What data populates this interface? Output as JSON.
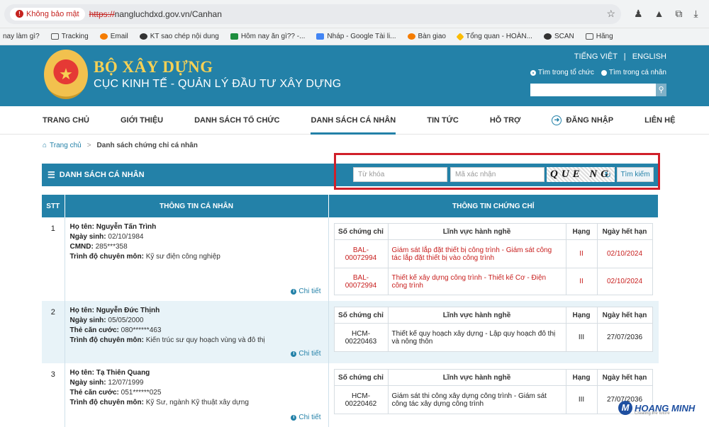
{
  "browser": {
    "security_label": "Không bảo mật",
    "url_protocol": "https://",
    "url_rest": "nangluchdxd.gov.vn/Canhan",
    "bookmarks": [
      {
        "label": "nay làm gì?",
        "icon": "none"
      },
      {
        "label": "Tracking",
        "icon": "folder-icon"
      },
      {
        "label": "Email",
        "icon": "link-icon"
      },
      {
        "label": "KT sao chép nội dung",
        "icon": "person-icon"
      },
      {
        "label": "Hôm nay ăn gì?? -...",
        "icon": "sheet-icon"
      },
      {
        "label": "Nháp - Google Tài li...",
        "icon": "doc-icon"
      },
      {
        "label": "Bàn giao",
        "icon": "link-icon"
      },
      {
        "label": "Tổng quan - HOÀN...",
        "icon": "drive-icon"
      },
      {
        "label": "SCAN",
        "icon": "globe-icon"
      },
      {
        "label": "Hãng",
        "icon": "folder-icon"
      }
    ]
  },
  "header": {
    "title": "BỘ XÂY DỰNG",
    "subtitle": "CỤC KINH TẾ - QUẢN LÝ ĐẦU TƯ XÂY DỰNG",
    "lang_vi": "TIẾNG VIỆT",
    "lang_sep": "|",
    "lang_en": "ENGLISH",
    "radio_org": "Tìm trong tổ chức",
    "radio_person": "Tìm trong cá nhân"
  },
  "nav": {
    "items": [
      "TRANG CHỦ",
      "GIỚI THIỆU",
      "DANH SÁCH TỔ CHỨC",
      "DANH SÁCH CÁ NHÂN",
      "TIN TỨC",
      "HỖ TRỢ",
      "ĐĂNG NHẬP",
      "LIÊN HỆ"
    ]
  },
  "breadcrumb": {
    "home": "Trang chủ",
    "current": "Danh sách chứng chỉ cá nhân"
  },
  "list": {
    "title": "DANH SÁCH CÁ NHÂN",
    "keyword_placeholder": "Từ khóa",
    "captcha_placeholder": "Mã xác nhận",
    "captcha_text": "QUE NG",
    "search_button": "Tìm kiếm"
  },
  "table": {
    "col_stt": "STT",
    "col_personal": "THÔNG TIN CÁ NHÂN",
    "col_cert": "THÔNG TIN CHỨNG CHỈ",
    "cert_headers": [
      "Số chứng chỉ",
      "Lĩnh vực hành nghề",
      "Hạng",
      "Ngày hết hạn"
    ],
    "detail_label": "Chi tiết",
    "rows": [
      {
        "stt": "1",
        "name_label": "Họ tên:",
        "name": "Nguyễn Tấn Trình",
        "dob_label": "Ngày sinh:",
        "dob": "02/10/1984",
        "id_label": "CMND:",
        "id": "285***358",
        "edu_label": "Trình độ chuyên môn:",
        "edu": "Kỹ sư điện công nghiệp",
        "certs": [
          {
            "no": "BAL-00072994",
            "field": "Giám sát lắp đặt thiết bị công trình - Giám sát công tác lắp đặt thiết bị vào công trình",
            "grade": "II",
            "expiry": "02/10/2024"
          },
          {
            "no": "BAL-00072994",
            "field": "Thiết kế xây dựng công trình - Thiết kế Cơ - Điện công trình",
            "grade": "II",
            "expiry": "02/10/2024"
          }
        ]
      },
      {
        "stt": "2",
        "name_label": "Họ tên:",
        "name": "Nguyễn Đức Thịnh",
        "dob_label": "Ngày sinh:",
        "dob": "05/05/2000",
        "id_label": "Thẻ căn cước:",
        "id": "080******463",
        "edu_label": "Trình độ chuyên môn:",
        "edu": "Kiến trúc sư quy hoạch vùng và đô thị",
        "certs": [
          {
            "no": "HCM-00220463",
            "field": "Thiết kế quy hoạch xây dựng - Lập quy hoạch đô thị và nông thôn",
            "grade": "III",
            "expiry": "27/07/2036"
          }
        ]
      },
      {
        "stt": "3",
        "name_label": "Họ tên:",
        "name": "Tạ Thiên Quang",
        "dob_label": "Ngày sinh:",
        "dob": "12/07/1999",
        "id_label": "Thẻ căn cước:",
        "id": "051******025",
        "edu_label": "Trình độ chuyên môn:",
        "edu": "Kỹ Sư, ngành Kỹ thuật xây dựng",
        "certs": [
          {
            "no": "HCM-00220462",
            "field": "Giám sát thi công xây dựng công trình - Giám sát công tác xây dựng công trình",
            "grade": "III",
            "expiry": "27/07/2036"
          }
        ]
      }
    ]
  },
  "watermark": {
    "brand": "HOANG MINH",
    "tagline": "Creating the future"
  },
  "colors": {
    "primary": "#2381a8",
    "highlight_border": "#d0202a",
    "cert_text_red": "#c8201f"
  }
}
